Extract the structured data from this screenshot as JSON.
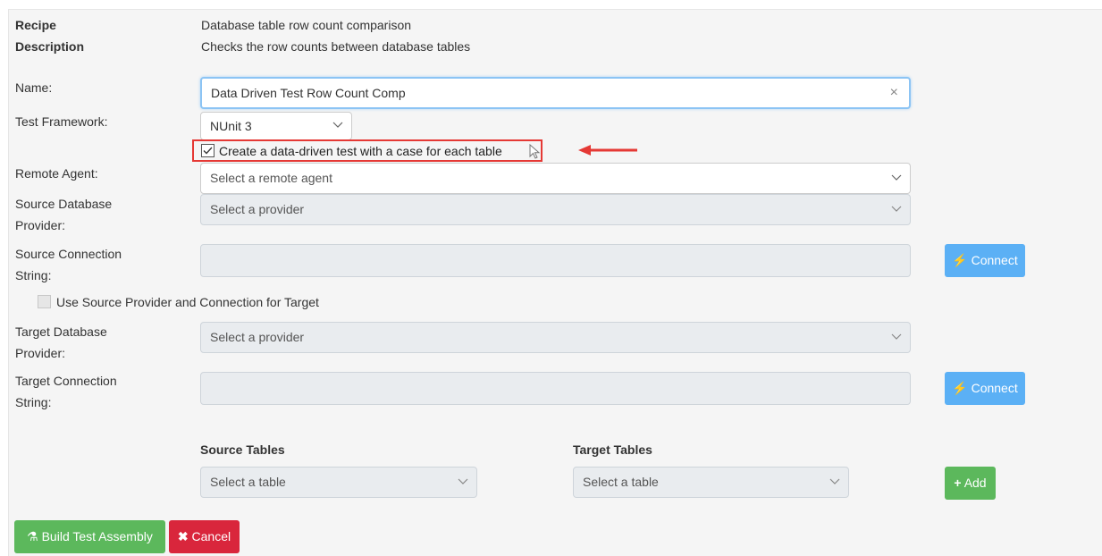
{
  "recipe": {
    "label": "Recipe",
    "value": "Database table row count comparison",
    "description_label": "Description",
    "description_value": "Checks the row counts between database tables"
  },
  "name": {
    "label": "Name:",
    "value": "Data Driven Test Row Count Comp"
  },
  "framework": {
    "label": "Test Framework:",
    "value": "NUnit 3"
  },
  "data_driven": {
    "label": "Create a data-driven test with a case for each table",
    "checked": true
  },
  "remote_agent": {
    "label": "Remote Agent:",
    "value": "Select a remote agent"
  },
  "source_provider": {
    "label_line1": "Source Database",
    "label_line2": "Provider:",
    "value": "Select a provider"
  },
  "source_connection": {
    "label_line1": "Source Connection",
    "label_line2": "String:",
    "button_label": "Connect"
  },
  "use_source": {
    "label": "Use Source Provider and Connection for Target",
    "checked": false
  },
  "target_provider": {
    "label_line1": "Target Database",
    "label_line2": "Provider:",
    "value": "Select a provider"
  },
  "target_connection": {
    "label_line1": "Target Connection",
    "label_line2": "String:",
    "button_label": "Connect"
  },
  "tables": {
    "source_header": "Source Tables",
    "source_value": "Select a table",
    "target_header": "Target Tables",
    "target_value": "Select a table",
    "add_label": "Add"
  },
  "actions": {
    "build_label": "Build Test Assembly",
    "cancel_label": "Cancel"
  },
  "colors": {
    "primary": "#5bb0f5",
    "success": "#5cb85c",
    "danger": "#d9263c",
    "annotation": "#e53935"
  }
}
